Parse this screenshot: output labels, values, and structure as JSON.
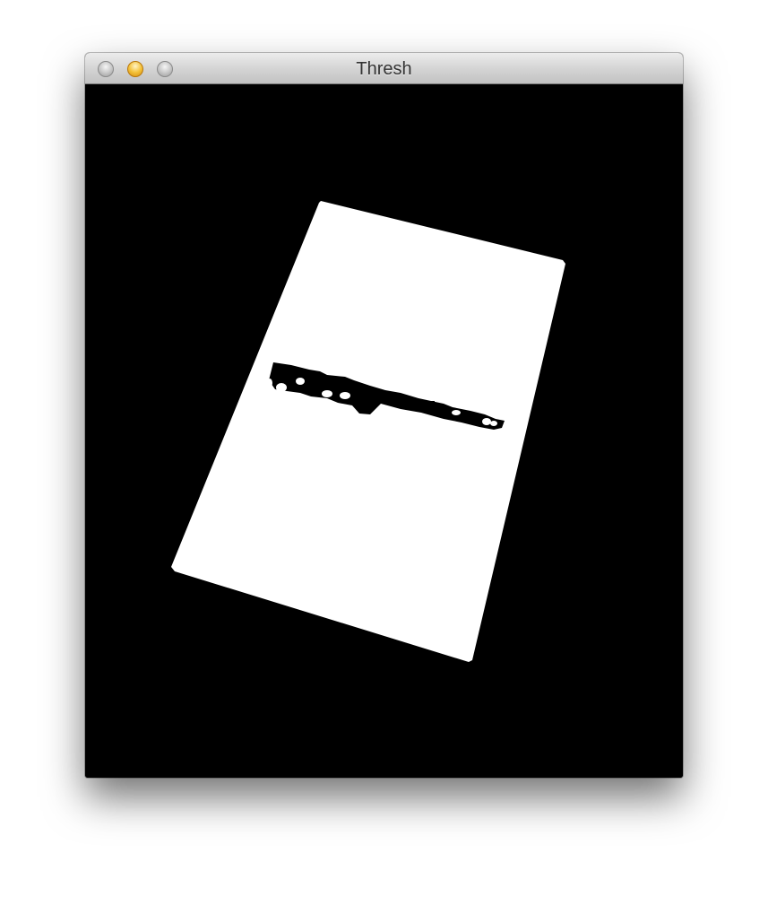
{
  "window": {
    "title": "Thresh"
  },
  "title_buttons": {
    "close_icon": "traffic-light-close",
    "minimize_icon": "traffic-light-minimize",
    "zoom_icon": "traffic-light-zoom"
  },
  "image": {
    "description_type": "binary threshold output",
    "foreground_color": "#ffffff",
    "background_color": "#000000"
  }
}
